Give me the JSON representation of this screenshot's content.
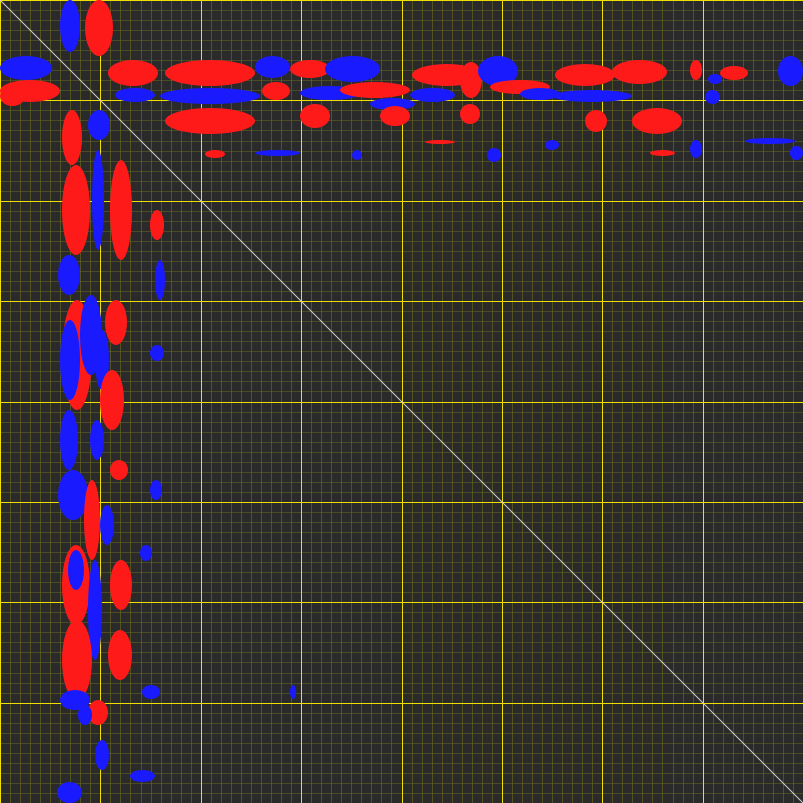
{
  "colors": {
    "background": "#2a2a2a",
    "grid_minor": "#6e6e1e",
    "grid_major": "#f0e000",
    "diagonal": "#d0d0d0",
    "positive": "#ff1a1a",
    "negative": "#1a1aff"
  },
  "grid": {
    "major_divisions": 8,
    "minor_per_major": 10,
    "shown": true
  },
  "features": {
    "diagonal_line": true,
    "contour_signs": [
      "positive",
      "negative"
    ]
  }
}
